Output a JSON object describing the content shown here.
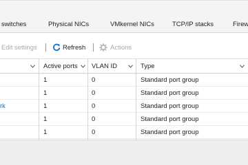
{
  "tabs": {
    "items": [
      "switches",
      "Physical NICs",
      "VMkernel NICs",
      "TCP/IP stacks",
      "Firew"
    ]
  },
  "toolbar": {
    "edit_settings": "Edit settings",
    "refresh": "Refresh",
    "actions": "Actions"
  },
  "table": {
    "columns": [
      "Active ports",
      "VLAN ID",
      "Type"
    ],
    "rows": [
      {
        "name": "",
        "active_ports": "1",
        "vlan_id": "0",
        "type": "Standard port group"
      },
      {
        "name": "",
        "active_ports": "1",
        "vlan_id": "0",
        "type": "Standard port group"
      },
      {
        "name": "rk",
        "active_ports": "1",
        "vlan_id": "0",
        "type": "Standard port group"
      },
      {
        "name": "",
        "active_ports": "1",
        "vlan_id": "0",
        "type": "Standard port group"
      },
      {
        "name": "",
        "active_ports": "1",
        "vlan_id": "0",
        "type": "Standard port group"
      }
    ]
  },
  "colors": {
    "link": "#2a6ea6",
    "refresh_icon": "#1a73c9",
    "disabled": "#a9a9a9"
  }
}
